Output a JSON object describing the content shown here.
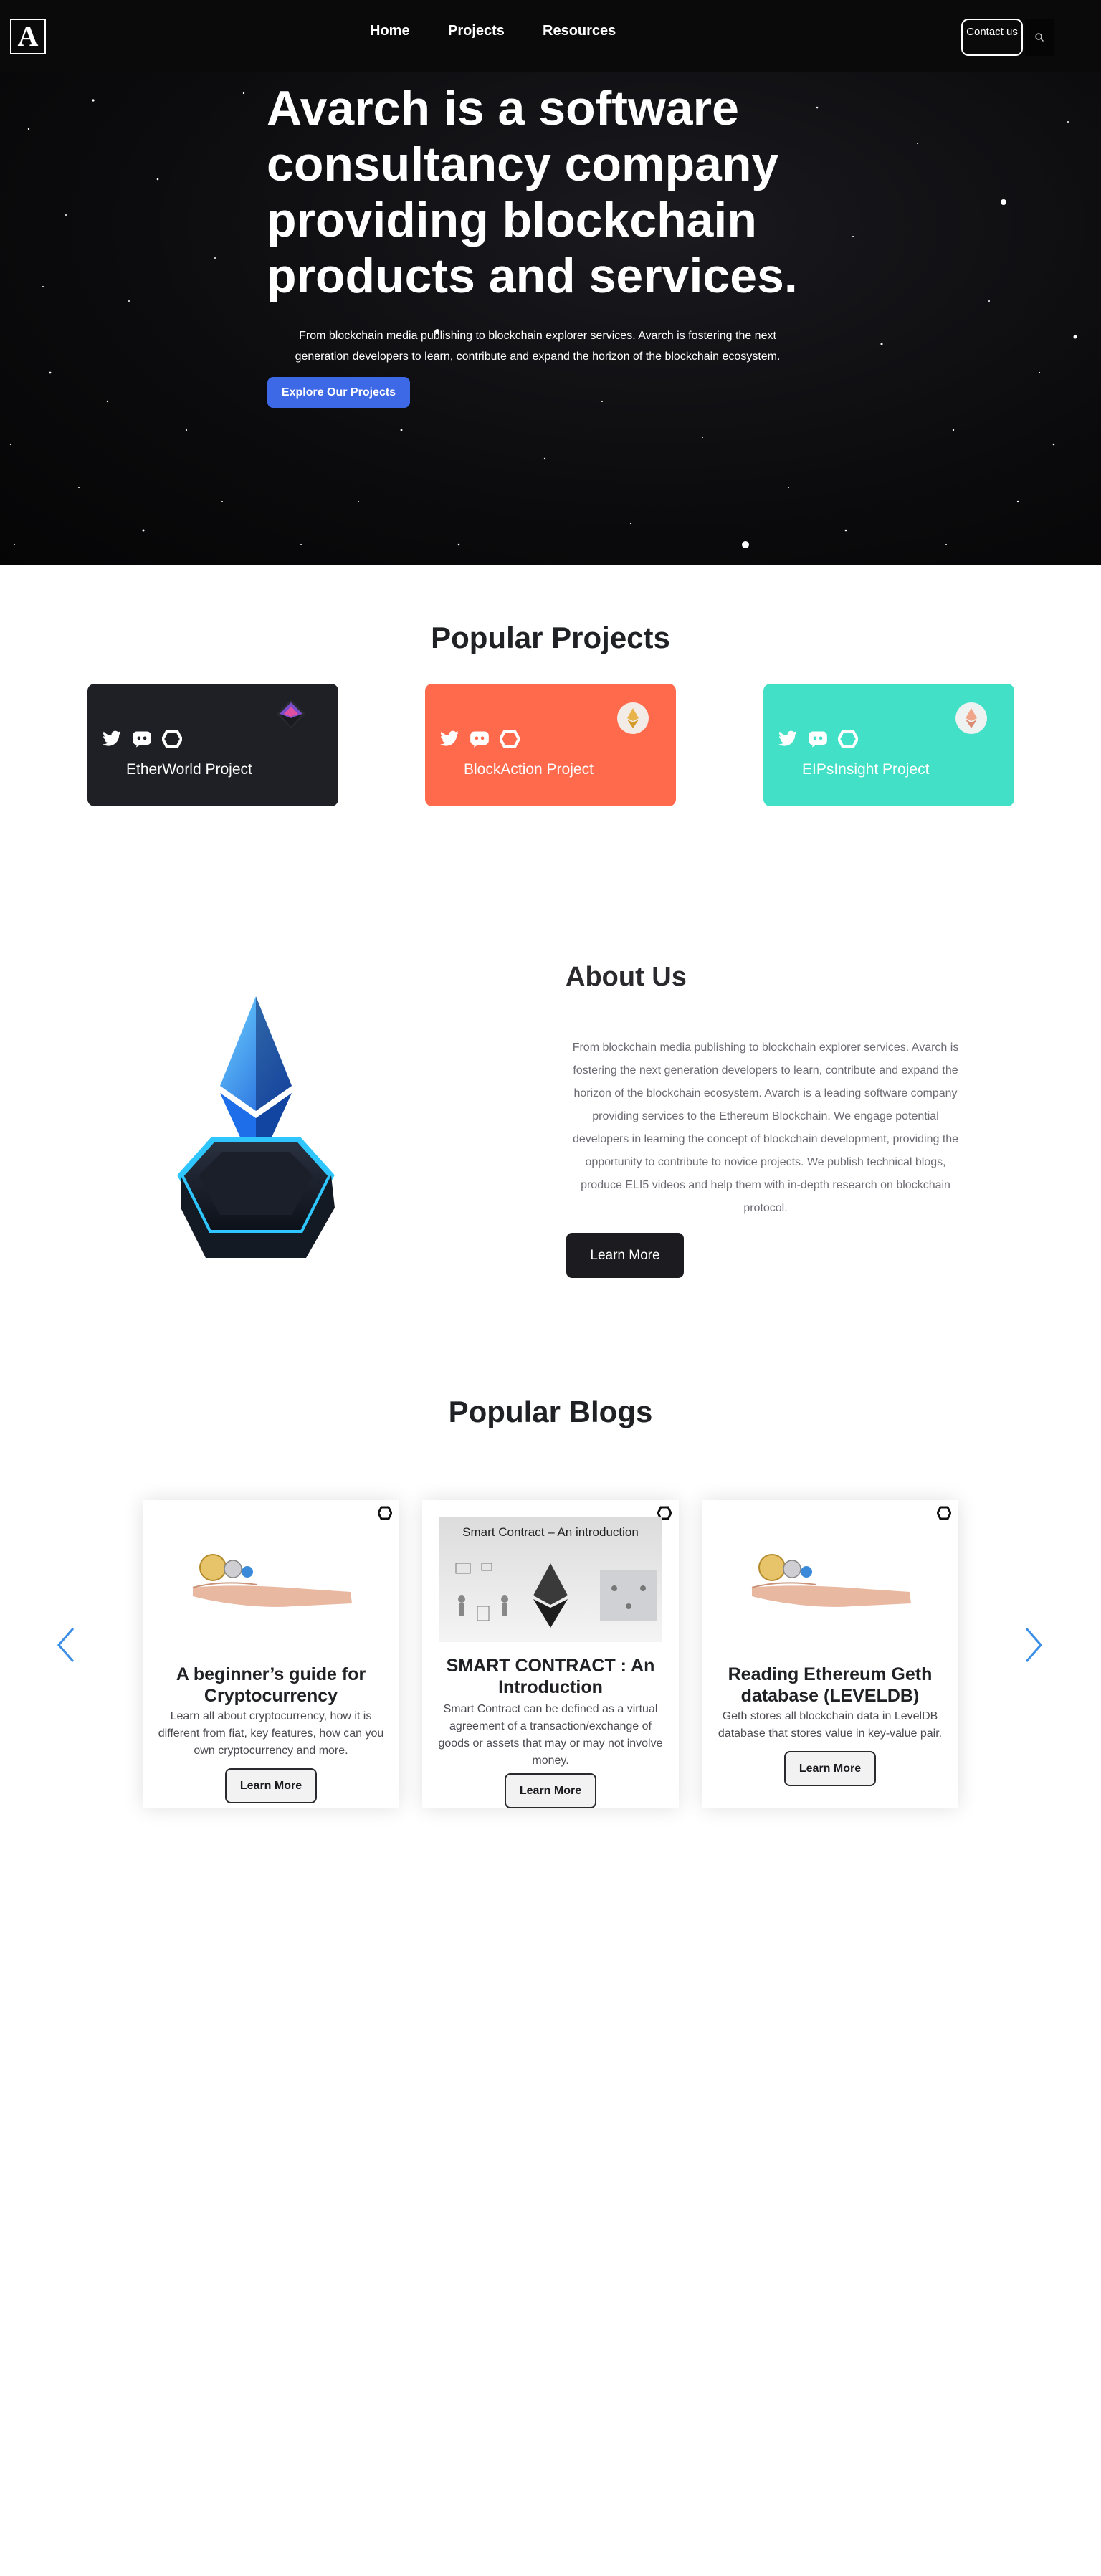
{
  "nav": {
    "logo_letter": "A",
    "links": [
      "Home",
      "Projects",
      "Resources"
    ],
    "contact_label": "Contact us"
  },
  "hero": {
    "title": "Avarch is a software consultancy company providing blockchain products and services.",
    "subtitle": "From blockchain media publishing to blockchain explorer services. Avarch is fostering the next generation developers to learn, contribute and expand the horizon of the blockchain ecosystem.",
    "cta_label": "Explore Our Projects"
  },
  "projects": {
    "title": "Popular Projects",
    "items": [
      {
        "name": "EtherWorld Project",
        "color": "#1f2025"
      },
      {
        "name": "BlockAction Project",
        "color": "#ff6a4d"
      },
      {
        "name": "EIPsInsight Project",
        "color": "#42e0c6"
      }
    ]
  },
  "about": {
    "title": "About Us",
    "text": "From blockchain media publishing to blockchain explorer services. Avarch is fostering the next generation developers to learn, contribute and expand the horizon of the blockchain ecosystem. Avarch is a leading software company providing services to the Ethereum Blockchain. We engage potential developers in learning the concept of blockchain development, providing the opportunity to contribute to novice projects. We publish technical blogs, produce ELI5 videos and help them with in-depth research on blockchain protocol.",
    "cta_label": "Learn More"
  },
  "blogs": {
    "title": "Popular Blogs",
    "items": [
      {
        "title": "A beginner’s guide for Cryptocurrency",
        "description": "Learn all about cryptocurrency, how it is different from fiat, key features, how can you own cryptocurrency and more.",
        "cta_label": "Learn More"
      },
      {
        "image_caption": "Smart Contract – An introduction",
        "title": "SMART CONTRACT : An Introduction",
        "description": "Smart Contract can be defined as a virtual agreement of a transaction/exchange of goods or assets that may or may not involve money.",
        "cta_label": "Learn More"
      },
      {
        "title": "Reading Ethereum Geth database (LEVELDB)",
        "description": "Geth stores all blockchain data in LevelDB database that stores value in key-value pair.",
        "cta_label": "Learn More"
      }
    ]
  },
  "colors": {
    "accent_blue": "#3d68e6",
    "arrow_blue": "#3a8ee6",
    "dark": "#1c1c20"
  }
}
